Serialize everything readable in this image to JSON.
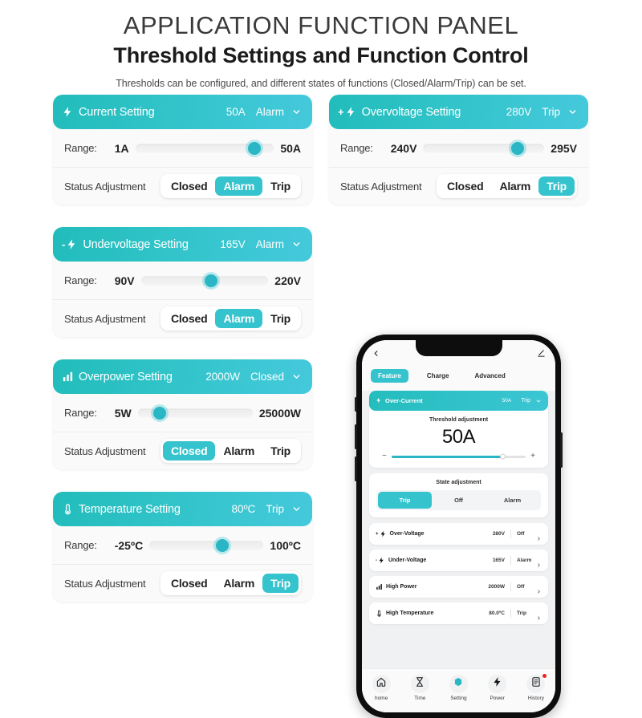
{
  "header": {
    "title": "APPLICATION FUNCTION PANEL",
    "subtitle": "Threshold Settings and Function Control",
    "description": "Thresholds can be configured, and different states of functions (Closed/Alarm/Trip) can be set."
  },
  "labels": {
    "range": "Range:",
    "status_adjustment": "Status Adjustment"
  },
  "colors": {
    "teal_dark": "#22bcbb",
    "teal_light": "#45c9dc",
    "accent": "#35c3cd",
    "badge_red": "#ee2222"
  },
  "cards": [
    {
      "icon": "bolt-icon",
      "sign": "",
      "title": "Current Setting",
      "value": "50A",
      "state": "Alarm",
      "range_min": "1A",
      "range_max": "50A",
      "slider_percent": 86,
      "options": [
        "Closed",
        "Alarm",
        "Trip"
      ],
      "active_option": "Alarm"
    },
    {
      "icon": "bolt-icon",
      "sign": "+",
      "title": "Overvoltage Setting",
      "value": "280V",
      "state": "Trip",
      "range_min": "240V",
      "range_max": "295V",
      "slider_percent": 78,
      "options": [
        "Closed",
        "Alarm",
        "Trip"
      ],
      "active_option": "Trip"
    },
    {
      "icon": "bolt-icon",
      "sign": "-",
      "title": "Undervoltage Setting",
      "value": "165V",
      "state": "Alarm",
      "range_min": "90V",
      "range_max": "220V",
      "slider_percent": 55,
      "options": [
        "Closed",
        "Alarm",
        "Trip"
      ],
      "active_option": "Alarm"
    },
    {
      "icon": "bars-icon",
      "sign": "",
      "title": "Overpower Setting",
      "value": "2000W",
      "state": "Closed",
      "range_min": "5W",
      "range_max": "25000W",
      "slider_percent": 19,
      "options": [
        "Closed",
        "Alarm",
        "Trip"
      ],
      "active_option": "Closed"
    },
    {
      "icon": "thermometer-icon",
      "sign": "",
      "title": "Temperature Setting",
      "value": "80ºC",
      "state": "Trip",
      "range_min": "-25ºC",
      "range_max": "100ºC",
      "slider_percent": 64,
      "options": [
        "Closed",
        "Alarm",
        "Trip"
      ],
      "active_option": "Trip"
    }
  ],
  "phone": {
    "topbar": {
      "back_icon": "chevron-left-icon",
      "edit_icon": "pencil-edit-icon"
    },
    "tabs": [
      {
        "label": "Feature",
        "active": true
      },
      {
        "label": "Charge",
        "active": false
      },
      {
        "label": "Advanced",
        "active": false
      }
    ],
    "main_card": {
      "icon": "bolt-icon",
      "title": "Over-Current",
      "value": "50A",
      "state": "Trip",
      "threshold_label": "Threshold adjustment",
      "threshold_value": "50A",
      "slider_percent": 83,
      "minus": "−",
      "plus": "+",
      "state_label": "State adjustment",
      "state_options": [
        "Trip",
        "Off",
        "Alarm"
      ],
      "state_active": "Trip"
    },
    "list": [
      {
        "icon": "bolt-plus-icon",
        "name": "Over-Voltage",
        "value": "280V",
        "state": "Off"
      },
      {
        "icon": "bolt-minus-icon",
        "name": "Under-Voltage",
        "value": "165V",
        "state": "Alarm"
      },
      {
        "icon": "bars-icon",
        "name": "High Power",
        "value": "2000W",
        "state": "Off"
      },
      {
        "icon": "thermometer-icon",
        "name": "High Temperature",
        "value": "80.0ºC",
        "state": "Trip"
      }
    ],
    "nav": [
      {
        "icon": "home-icon",
        "label": "home",
        "active": false,
        "badge": false
      },
      {
        "icon": "hourglass-icon",
        "label": "Time",
        "active": false,
        "badge": false
      },
      {
        "icon": "settings-hex-icon",
        "label": "Setting",
        "active": true,
        "badge": false
      },
      {
        "icon": "power-bolt-icon",
        "label": "Power",
        "active": false,
        "badge": false
      },
      {
        "icon": "history-doc-icon",
        "label": "History",
        "active": false,
        "badge": true
      }
    ]
  }
}
